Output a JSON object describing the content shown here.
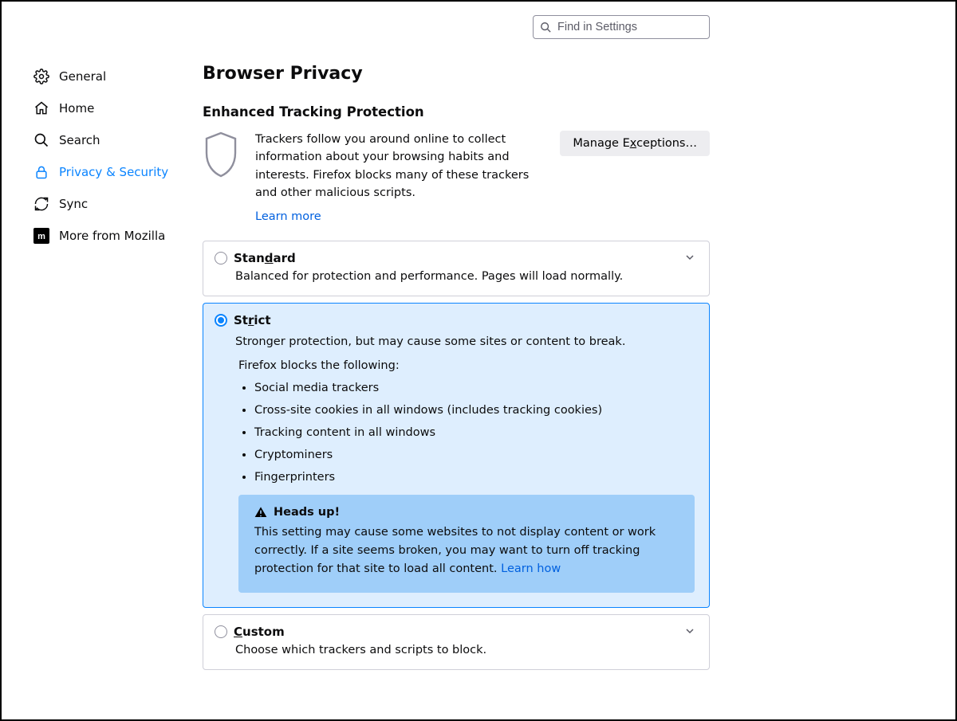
{
  "search": {
    "placeholder": "Find in Settings"
  },
  "sidebar": {
    "items": [
      {
        "label": "General"
      },
      {
        "label": "Home"
      },
      {
        "label": "Search"
      },
      {
        "label": "Privacy & Security"
      },
      {
        "label": "Sync"
      },
      {
        "label": "More from Mozilla"
      }
    ]
  },
  "page": {
    "title": "Browser Privacy",
    "section": "Enhanced Tracking Protection",
    "intro": "Trackers follow you around online to collect information about your browsing habits and interests. Firefox blocks many of these trackers and other malicious scripts.",
    "learn_more": "Learn more",
    "manage_exceptions": {
      "pre": "Manage E",
      "u": "x",
      "post": "ceptions…"
    }
  },
  "options": {
    "standard": {
      "title_pre": "Stan",
      "title_u": "d",
      "title_post": "ard",
      "desc": "Balanced for protection and performance. Pages will load normally."
    },
    "strict": {
      "title_pre": "St",
      "title_u": "r",
      "title_post": "ict",
      "desc": "Stronger protection, but may cause some sites or content to break.",
      "blocks_label": "Firefox blocks the following:",
      "blocks": [
        "Social media trackers",
        "Cross-site cookies in all windows (includes tracking cookies)",
        "Tracking content in all windows",
        "Cryptominers",
        "Fingerprinters"
      ],
      "warn_title": "Heads up!",
      "warn_body_pre": "This setting may cause some websites to not display content or work correctly. If a site seems broken, you may want to turn off tracking protection for that site to load all content.   ",
      "warn_link": "Learn how"
    },
    "custom": {
      "title_pre": "",
      "title_u": "C",
      "title_post": "ustom",
      "desc": "Choose which trackers and scripts to block."
    }
  }
}
